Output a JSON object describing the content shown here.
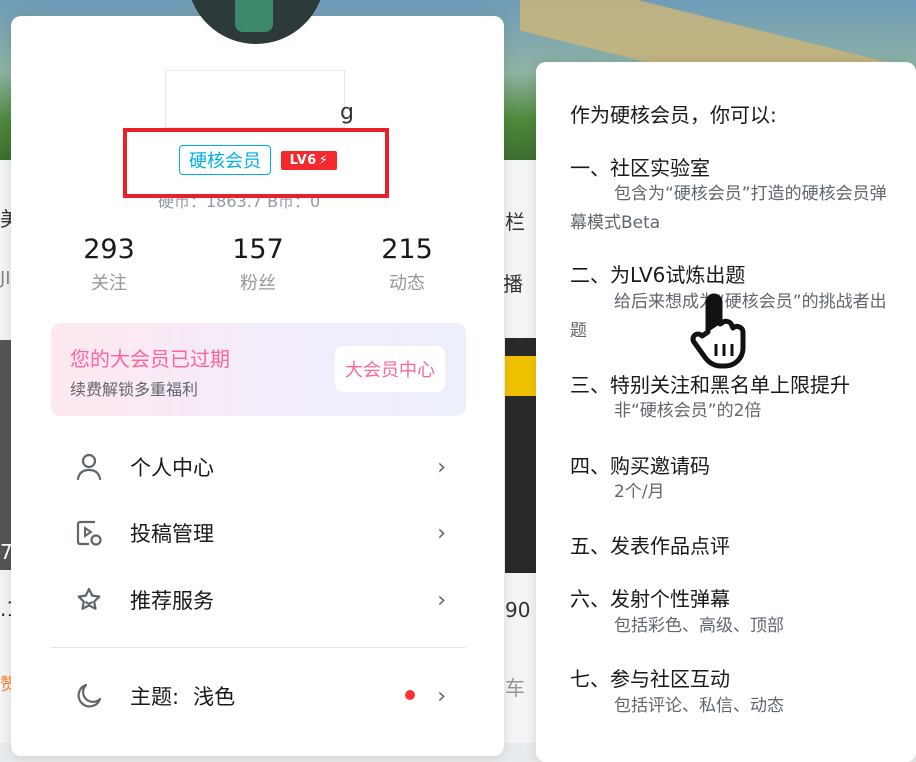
{
  "background": {
    "left_text": [
      "美",
      "JI",
      "7",
      ".1",
      "赞"
    ],
    "right_text": [
      "栏",
      "播",
      "90",
      "车"
    ]
  },
  "profile": {
    "username_tail": "g",
    "badge": "硬核会员",
    "level": "LV6",
    "coins_text": "硬币：1863.7    B币：0",
    "stats": [
      {
        "value": "293",
        "label": "关注"
      },
      {
        "value": "157",
        "label": "粉丝"
      },
      {
        "value": "215",
        "label": "动态"
      }
    ],
    "vip": {
      "title": "您的大会员已过期",
      "subtitle": "续费解锁多重福利",
      "button": "大会员中心"
    },
    "menu": [
      {
        "label": "个人中心",
        "icon": "person-icon"
      },
      {
        "label": "投稿管理",
        "icon": "upload-manage-icon"
      },
      {
        "label": "推荐服务",
        "icon": "star-icon"
      }
    ],
    "theme": {
      "label": "主题:",
      "value": "浅色",
      "icon": "moon-icon"
    }
  },
  "tooltip": {
    "title": "作为硬核会员，你可以:",
    "items": [
      {
        "heading": "一、社区实验室",
        "desc": "包含为“硬核会员”打造的硬核会员弹幕模式Beta"
      },
      {
        "heading": "二、为LV6试炼出题",
        "desc": "给后来想成为“硬核会员”的挑战者出题"
      },
      {
        "heading": "三、特别关注和黑名单上限提升",
        "desc": "非“硬核会员”的2倍"
      },
      {
        "heading": "四、购买邀请码",
        "desc": "2个/月"
      },
      {
        "heading": "五、发表作品点评",
        "desc": ""
      },
      {
        "heading": "六、发射个性弹幕",
        "desc": "包括彩色、高级、顶部"
      },
      {
        "heading": "七、参与社区互动",
        "desc": "包括评论、私信、动态"
      }
    ]
  },
  "colors": {
    "accent_blue": "#00aeec",
    "pink": "#ff6699",
    "level_red": "#f3292d",
    "highlight_red": "#e8202a"
  }
}
